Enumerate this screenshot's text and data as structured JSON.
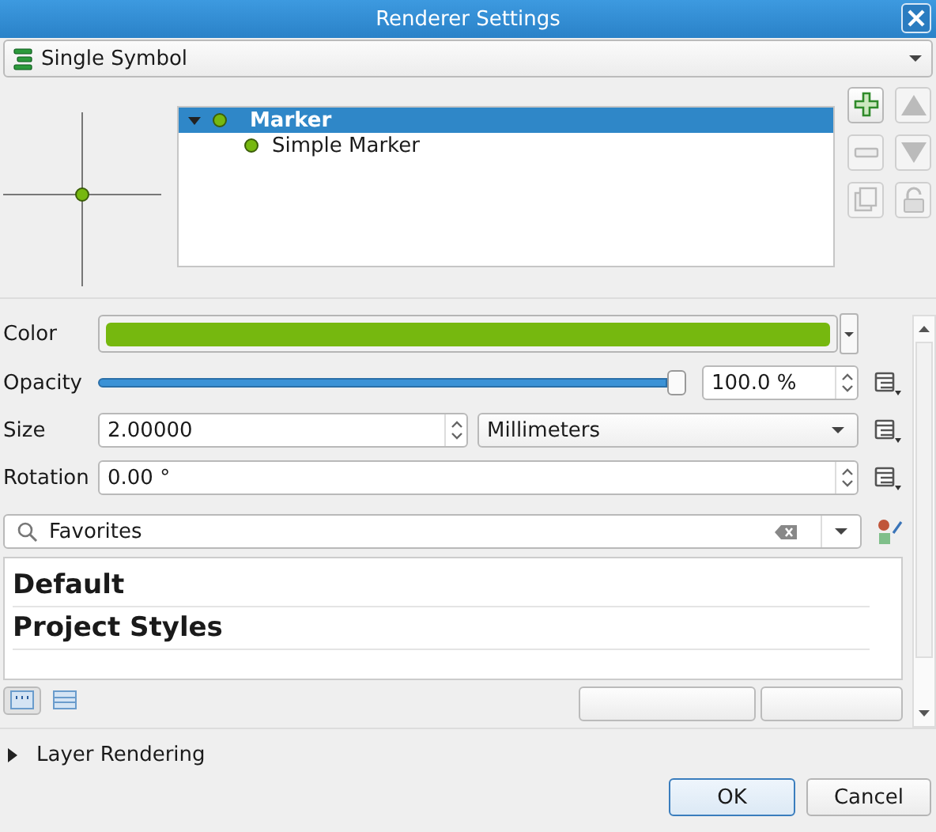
{
  "window": {
    "title": "Renderer Settings"
  },
  "renderer": {
    "value": "Single Symbol"
  },
  "symbol_tree": [
    {
      "label": "Marker",
      "selected": true,
      "expanded": true,
      "children": [
        {
          "label": "Simple Marker",
          "selected": false
        }
      ]
    }
  ],
  "layer_tools": [
    {
      "kind": "add",
      "disabled": false
    },
    {
      "kind": "up",
      "disabled": true
    },
    {
      "kind": "remove",
      "disabled": true
    },
    {
      "kind": "down",
      "disabled": true
    },
    {
      "kind": "duplicate",
      "disabled": true
    },
    {
      "kind": "lock",
      "disabled": true
    }
  ],
  "properties": {
    "color": {
      "label": "Color",
      "color": "#76b80f"
    },
    "opacity": {
      "label": "Opacity",
      "level": 1.0,
      "reading": "100.0 %"
    },
    "size": {
      "label": "Size",
      "value": "2.00000",
      "unit": "Millimeters"
    },
    "rotation": {
      "label": "Rotation",
      "value": "0.00 °"
    }
  },
  "library": {
    "search": {
      "value": "Favorites"
    },
    "groups": [
      "Default",
      "Project Styles"
    ],
    "view_modes": [
      {
        "kind": "icons",
        "selected": true
      },
      {
        "kind": "list",
        "selected": false
      }
    ]
  },
  "layer_rendering": {
    "label": "Layer Rendering",
    "expanded": false
  },
  "buttons": [
    {
      "label": "OK",
      "default": true
    },
    {
      "label": "Cancel",
      "default": false
    }
  ]
}
